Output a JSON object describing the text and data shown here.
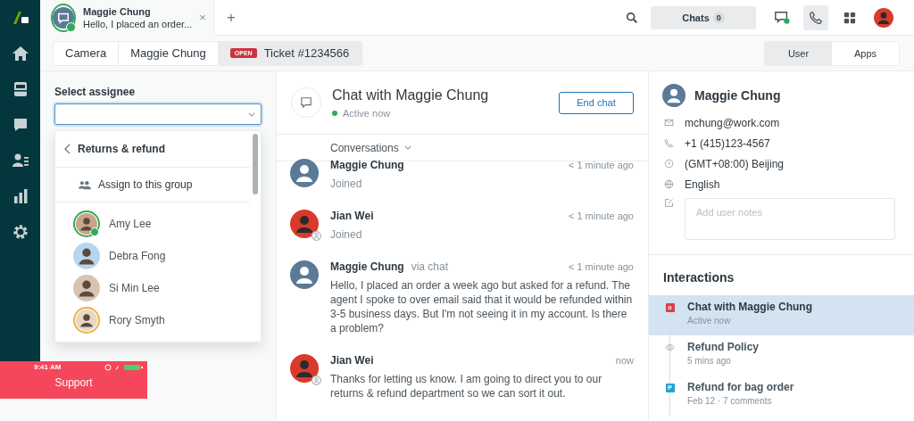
{
  "nav": [
    {
      "kind": "logo"
    },
    {
      "kind": "home"
    },
    {
      "kind": "inbox"
    },
    {
      "kind": "chat"
    },
    {
      "kind": "contacts"
    },
    {
      "kind": "reports"
    },
    {
      "kind": "settings"
    }
  ],
  "top_tab": {
    "title": "Maggie Chung",
    "preview": "Hello, I placed an order...",
    "close": "×",
    "online": true
  },
  "add_tab": "+",
  "chats_button": {
    "label": "Chats",
    "count": "0"
  },
  "header_icons": [
    {
      "kind": "chat-status",
      "selected": false
    },
    {
      "kind": "phone",
      "selected": true
    },
    {
      "kind": "apps",
      "selected": false
    },
    {
      "kind": "avatar",
      "selected": false
    }
  ],
  "breadcrumbs": [
    {
      "label": "Camera",
      "selected": false
    },
    {
      "label": "Maggie Chung",
      "selected": false
    },
    {
      "label": "Ticket #1234566",
      "badge": "OPEN",
      "selected": true
    }
  ],
  "panel_tabs": [
    {
      "label": "User",
      "selected": true
    },
    {
      "label": "Apps",
      "selected": false
    }
  ],
  "assignee": {
    "label": "Select assignee",
    "group": "Returns & refund",
    "assign_group": "Assign to this group",
    "people": [
      {
        "name": "Amy Lee",
        "color": "#30aa5c",
        "online": true
      },
      {
        "name": "Debra Fong",
        "online": false
      },
      {
        "name": "Si Min Lee",
        "online": false
      },
      {
        "name": "Rory Smyth",
        "color": "#f0b040",
        "online": false
      }
    ]
  },
  "phone": {
    "time": "9:41 AM",
    "title": "Support"
  },
  "chat": {
    "title": "Chat with Maggie Chung",
    "status": "Active now",
    "end_button": "End chat",
    "filter": "Conversations",
    "messages": [
      {
        "author": "Maggie Chung",
        "kind": "customer",
        "time": "< 1 minute ago",
        "text": "Joined",
        "event": true
      },
      {
        "author": "Jian Wei",
        "kind": "agent",
        "time": "< 1 minute ago",
        "text": "Joined",
        "event": true
      },
      {
        "author": "Maggie Chung",
        "via": "via chat",
        "kind": "customer",
        "time": "< 1 minute ago",
        "text": "Hello, I placed an order a week ago but asked for a refund. The agent I spoke to over email said that it would be refunded within 3-5 business days. But I'm not seeing it in my account. Is there a problem?",
        "event": false
      },
      {
        "author": "Jian Wei",
        "kind": "agent",
        "time": "now",
        "text": "Thanks for letting us know. I am going to direct you to our returns & refund department so we can sort it out.",
        "event": false
      }
    ]
  },
  "user": {
    "name": "Maggie Chung",
    "details": [
      {
        "kind": "email",
        "text": "mchung@work.com"
      },
      {
        "kind": "phone",
        "text": "+1 (415)123-4567"
      },
      {
        "kind": "time",
        "text": "(GMT+08:00) Beijing"
      },
      {
        "kind": "language",
        "text": "English"
      }
    ],
    "notes_placeholder": "Add user notes"
  },
  "interactions": {
    "title": "Interactions",
    "items": [
      {
        "kind": "chat",
        "badge": "o",
        "title": "Chat with Maggie Chung",
        "meta": "Active now",
        "selected": true
      },
      {
        "kind": "article",
        "title": "Refund Policy",
        "meta": "5 mins ago",
        "selected": false
      },
      {
        "kind": "ticket",
        "badge": "P",
        "title": "Refund for bag order",
        "meta": "Feb 12 · 7 comments",
        "selected": false
      }
    ]
  }
}
